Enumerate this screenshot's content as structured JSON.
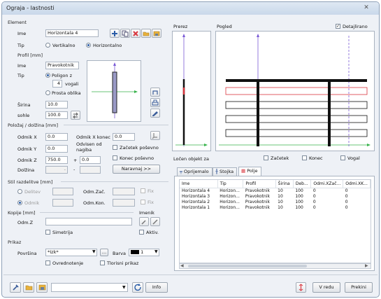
{
  "window": {
    "title": "Ograja - lastnosti",
    "close": "✕"
  },
  "element": {
    "header": "Element",
    "ime_label": "Ime",
    "ime_value": "Horizontala 4",
    "tip_label": "Tip",
    "tip_options": [
      "Vertikalno",
      "Horizontalno"
    ],
    "tip_selected": "Horizontalno"
  },
  "profil": {
    "header": "Profil  [mm]",
    "ime_label": "Ime",
    "ime_value": "Pravokotnik",
    "tip_label": "Tip",
    "poligon_label": "Poligon z",
    "vogali_value": "4",
    "vogali_label": "vogali",
    "prosta_label": "Prosta oblika",
    "sirina_label": "Širina",
    "sirina_value": "10.0",
    "sohle_label": "sohle",
    "sohle_value": "100.0"
  },
  "polozaj": {
    "header": "Položaj / dolžina [mm]",
    "odmik_x_label": "Odmik X",
    "odmik_x_value": "0.0",
    "odmik_x_konec_label": "Odmik X konec",
    "odmik_x_konec_value": "0.0",
    "odmik_y_label": "Odmik Y",
    "odmik_y_value": "0.0",
    "odvisen_label": "Odvisen od\nnagiba",
    "zacetek_label": "Začetek poševno",
    "odmik_z_label": "Odmik Z",
    "odmik_z_value": "750.0",
    "plus": "+",
    "odmik_z2_value": "0.0",
    "konec_label": "Konec poševno",
    "dolzina_label": "Dolžina",
    "dolzina_value": "-",
    "minus": "-",
    "naravnaj": "Naravnaj >>"
  },
  "stil": {
    "header": "Stil razdelitve [mm]",
    "delitev_label": "Delitev",
    "odmik_label": "Odmik",
    "odm_zac_label": "Odm.Zač.",
    "odm_kon_label": "Odm.Kon.",
    "fix1": "Fix",
    "fix2": "Fix"
  },
  "kopije": {
    "header": "Kopije [mm]",
    "odm_z_label": "Odm.Z",
    "simetrija_label": "Simetrija",
    "imenik_label": "Imenik",
    "aktiv_label": "Aktiv."
  },
  "prikaz": {
    "header": "Prikaz",
    "povrsina_label": "Površina",
    "povrsina_value": "*Izk*",
    "barva_label": "Barva",
    "barva_value": "1",
    "ovrednotenje_label": "Ovrednotenje",
    "tlorisni_label": "Tlorisni prikaz"
  },
  "prerez": {
    "label": "Prerez"
  },
  "pogled": {
    "label": "Pogled",
    "detajlirano_label": "Detajlirano",
    "detajlirano_checked": true
  },
  "locen": {
    "label": "Ločen objekt za",
    "zacetek_label": "Začetek",
    "konec_label": "Konec",
    "vogal_label": "Vogal"
  },
  "tabs": [
    {
      "label": "Oprijemalo"
    },
    {
      "label": "Stojka"
    },
    {
      "label": "Polje"
    }
  ],
  "table": {
    "headers": [
      "Ime",
      "Tip",
      "Profil",
      "Širina",
      "Deb...",
      "Odmi.XZač...",
      "Odmi.XK..."
    ],
    "rows": [
      [
        "Horizontala 4",
        "Horizon...",
        "Pravokotnik",
        "10",
        "100",
        "0",
        "0"
      ],
      [
        "Horizontala 3",
        "Horizon...",
        "Pravokotnik",
        "10",
        "100",
        "0",
        "0"
      ],
      [
        "Horizontala 2",
        "Horizon...",
        "Pravokotnik",
        "10",
        "100",
        "0",
        "0"
      ],
      [
        "Horizontala 1",
        "Horizon...",
        "Pravokotnik",
        "10",
        "100",
        "0",
        "0"
      ]
    ]
  },
  "footer": {
    "info": "Info",
    "v_redu": "V redu",
    "prekini": "Prekini"
  },
  "colors": {
    "accent": "#2b5da8",
    "red": "#d9363e",
    "green": "#36b24a",
    "purple": "#7a5bd6"
  }
}
